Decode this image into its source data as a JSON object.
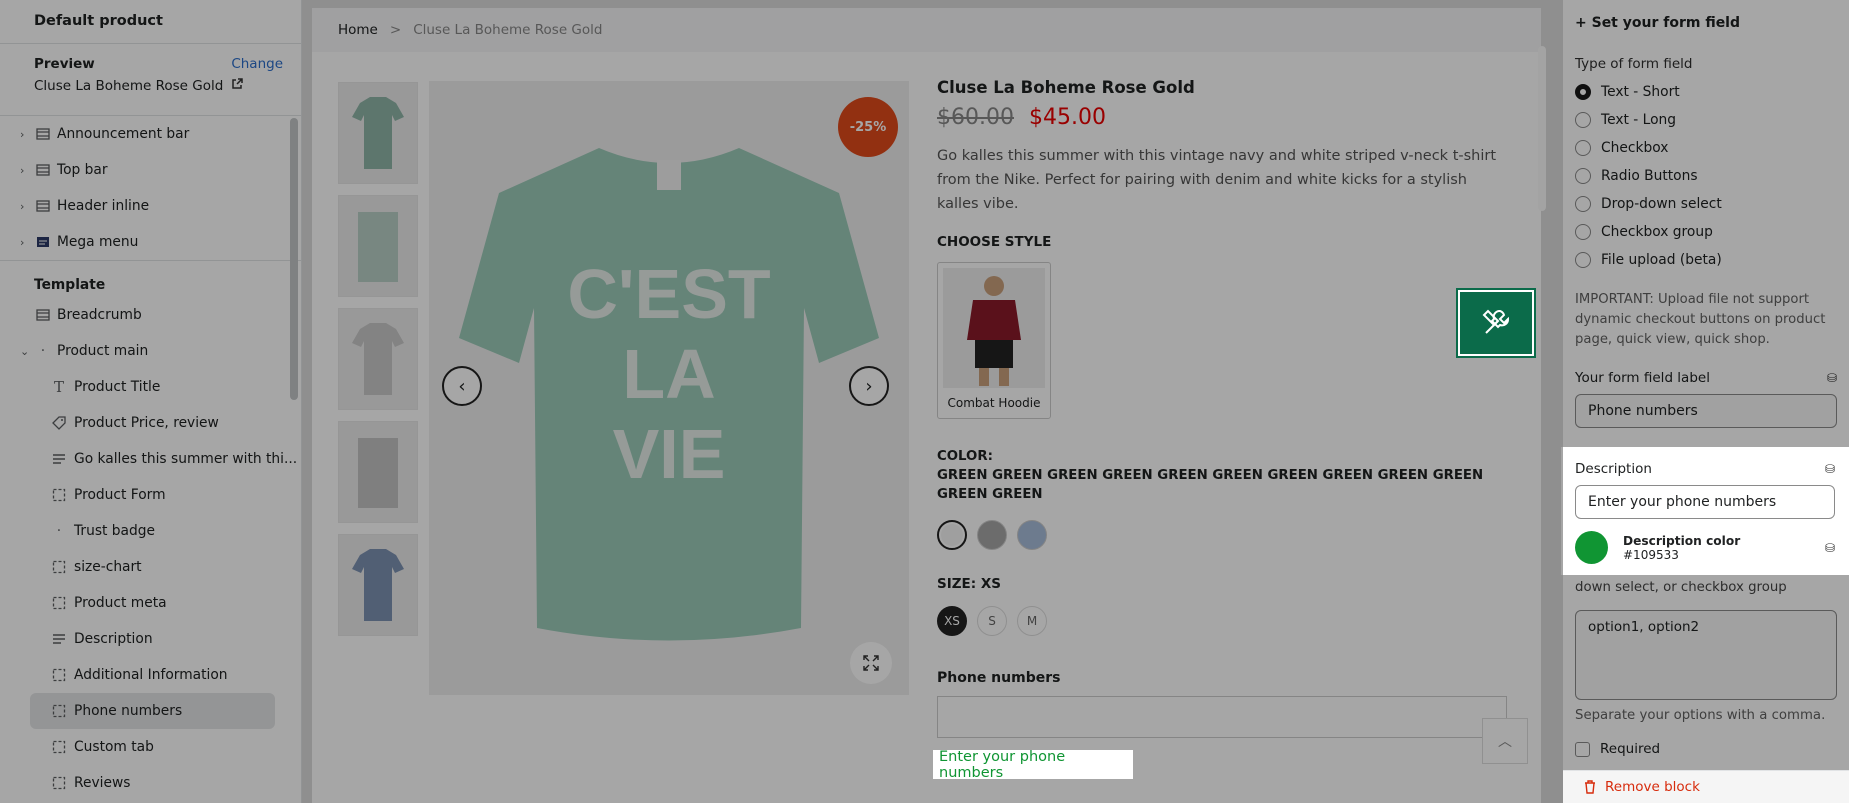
{
  "sidebar": {
    "title": "Default product",
    "preview_label": "Preview",
    "change_label": "Change",
    "preview_product": "Cluse La Boheme Rose Gold",
    "header_items": [
      {
        "label": "Announcement bar",
        "icon": "section-icon"
      },
      {
        "label": "Top bar",
        "icon": "section-icon"
      },
      {
        "label": "Header inline",
        "icon": "section-icon"
      },
      {
        "label": "Mega menu",
        "icon": "image-icon"
      }
    ],
    "template_label": "Template",
    "breadcrumb_item": "Breadcrumb",
    "product_main": "Product main",
    "blocks": [
      {
        "label": "Product Title",
        "icon": "text-icon"
      },
      {
        "label": "Product Price, review",
        "icon": "tag-icon"
      },
      {
        "label": "Go kalles this summer with thi...",
        "icon": "paragraph-icon"
      },
      {
        "label": "Product Form",
        "icon": "block-icon"
      },
      {
        "label": "Trust badge",
        "icon": "dot-icon"
      },
      {
        "label": "size-chart",
        "icon": "block-icon"
      },
      {
        "label": "Product meta",
        "icon": "block-icon"
      },
      {
        "label": "Description",
        "icon": "paragraph-icon"
      },
      {
        "label": "Additional Information",
        "icon": "block-icon"
      },
      {
        "label": "Phone numbers",
        "icon": "block-icon"
      },
      {
        "label": "Custom tab",
        "icon": "block-icon"
      },
      {
        "label": "Reviews",
        "icon": "block-icon"
      }
    ]
  },
  "preview": {
    "breadcrumb": {
      "home": "Home",
      "sep": ">",
      "current": "Cluse La Boheme Rose Gold"
    },
    "sale_badge": "-25%",
    "product_title": "Cluse La Boheme Rose Gold",
    "old_price": "$60.00",
    "new_price": "$45.00",
    "description": "Go kalles this summer with this vintage navy and white striped v-neck t-shirt from the Nike. Perfect for pairing with denim and white kicks for a stylish kalles vibe.",
    "choose_style": "CHOOSE STYLE",
    "style_name": "Combat Hoodie",
    "color_label": "COLOR:",
    "color_value": "GREEN GREEN GREEN GREEN GREEN GREEN GREEN GREEN GREEN GREEN GREEN GREEN",
    "swatch_colors": [
      "#f4f4f4",
      "#a7a7a7",
      "#a8bddb"
    ],
    "size_label": "SIZE: XS",
    "sizes": [
      "XS",
      "S",
      "M"
    ],
    "phone_label": "Phone numbers",
    "phone_help": "Enter your phone numbers",
    "tshirt_text": [
      "C'EST",
      "LA",
      "VIE"
    ]
  },
  "panel": {
    "heading": "+ Set your form field",
    "type_label": "Type of form field",
    "types": [
      {
        "label": "Text - Short",
        "selected": true
      },
      {
        "label": "Text - Long",
        "selected": false
      },
      {
        "label": "Checkbox",
        "selected": false
      },
      {
        "label": "Radio Buttons",
        "selected": false
      },
      {
        "label": "Drop-down select",
        "selected": false
      },
      {
        "label": "Checkbox group",
        "selected": false
      },
      {
        "label": "File upload (beta)",
        "selected": false
      }
    ],
    "important_note": "IMPORTANT: Upload file not support dynamic checkout buttons on product page, quick view, quick shop.",
    "field_label_title": "Your form field label",
    "field_label_value": "Phone numbers",
    "description_title": "Description",
    "description_value": "Enter your phone numbers",
    "desc_color_title": "Description color",
    "desc_color_value": "#109533",
    "options_label": "Options if using radio buttons, a drop-down select, or checkbox group",
    "options_value": "option1, option2",
    "options_hint": "Separate your options with a comma.",
    "required_label": "Required",
    "remove_label": "Remove block"
  },
  "colors": {
    "accent": "#109533",
    "sale": "#e14a1b",
    "price": "#ec0101",
    "tool": "#0b6b4a",
    "danger": "#d72c0d"
  }
}
